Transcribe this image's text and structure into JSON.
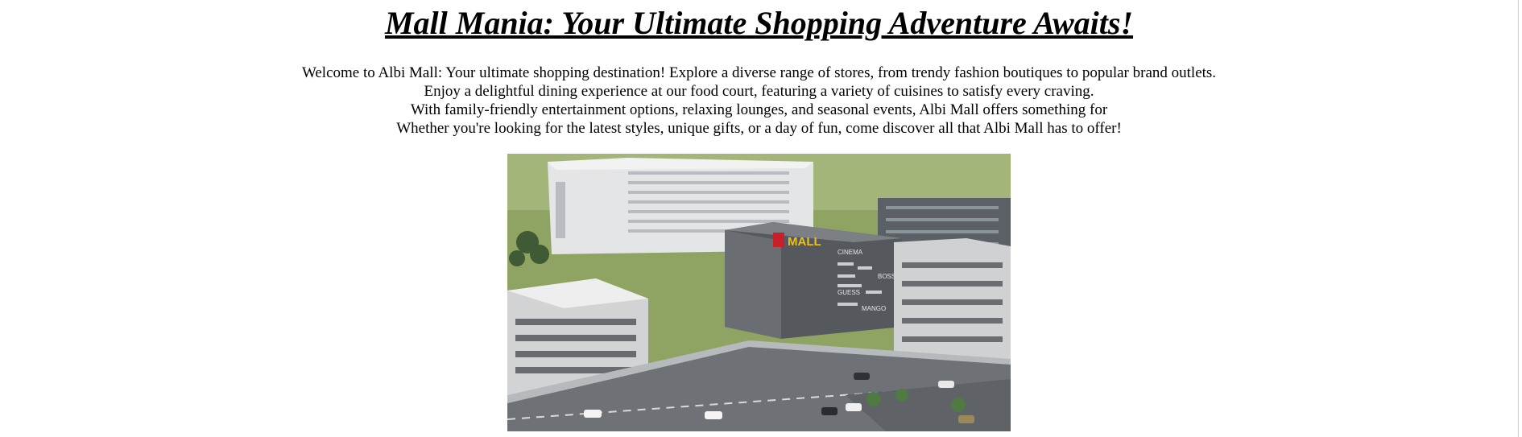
{
  "page": {
    "title": "Mall Mania: Your Ultimate Shopping Adventure Awaits!"
  },
  "intro": {
    "lines": [
      "Welcome to Albi Mall: Your ultimate shopping destination! Explore a diverse range of stores, from trendy fashion boutiques to popular brand outlets.",
      "Enjoy a delightful dining experience at our food court, featuring a variety of cuisines to satisfy every craving.",
      "With family-friendly entertainment options, relaxing lounges, and seasonal events, Albi Mall offers something for",
      "Whether you're looking for the latest styles, unique gifts, or a day of fun, come discover all that Albi Mall has to offer!"
    ]
  },
  "hero_image": {
    "sign_text": "MALL",
    "facade_brands": [
      "CINEMA",
      "BOSS",
      "GUESS",
      "MANGO"
    ],
    "colors": {
      "sky_grass": "#8fa463",
      "building_light": "#d9dadb",
      "facade_dark": "#55585c",
      "road": "#6e7276",
      "sign": "#e8c21a",
      "sign_red": "#c8202a"
    }
  }
}
